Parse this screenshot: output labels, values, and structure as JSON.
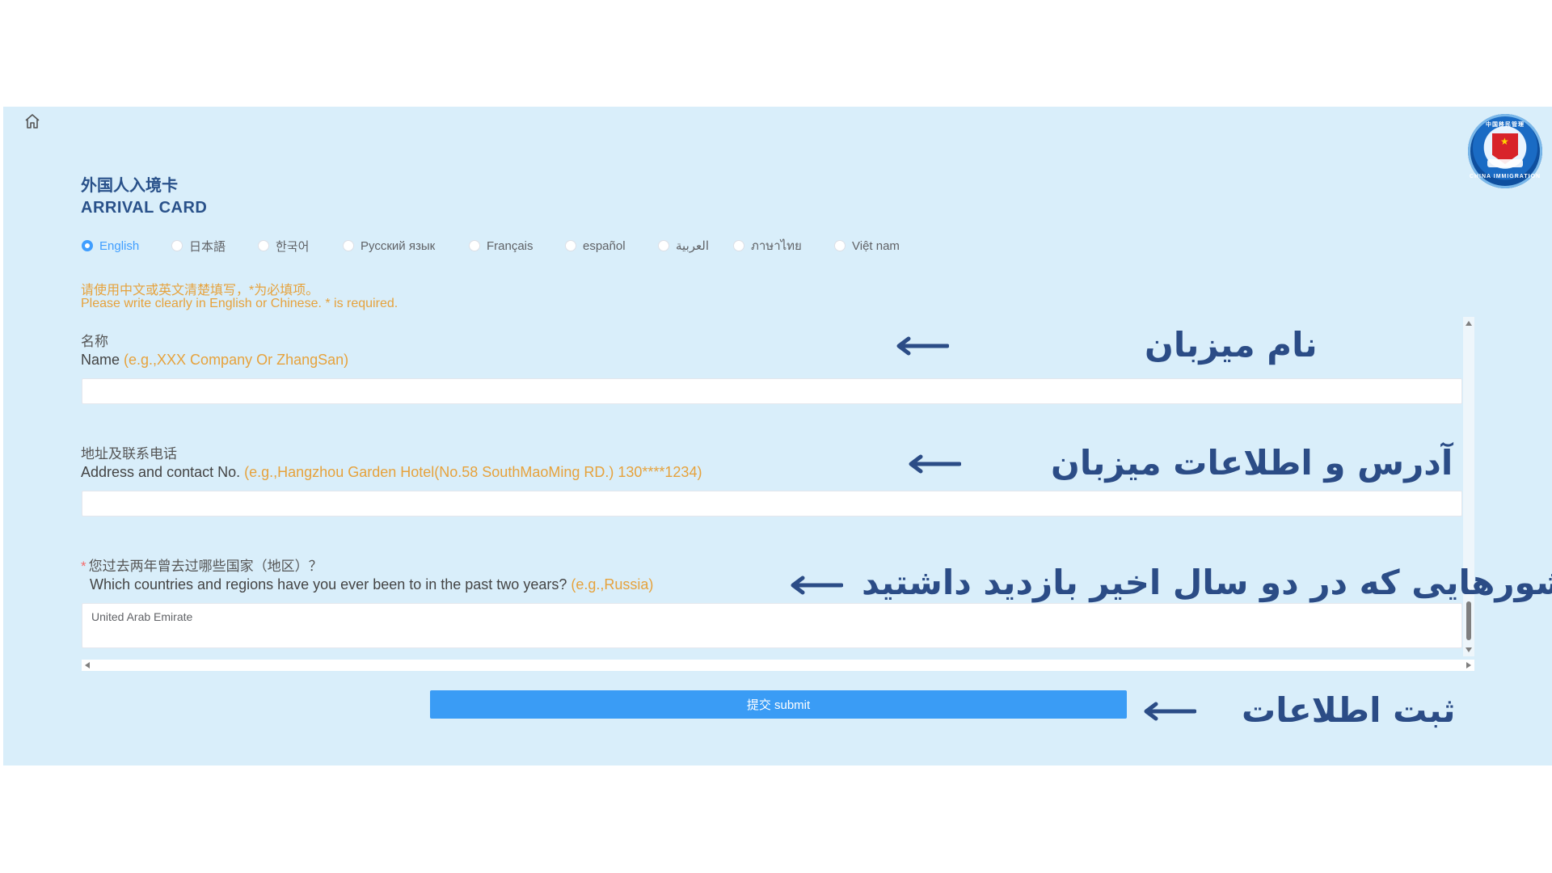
{
  "header": {
    "title_cn": "外国人入境卡",
    "title_en": "ARRIVAL CARD"
  },
  "languages": [
    {
      "label": "English",
      "selected": true
    },
    {
      "label": "日本語",
      "selected": false
    },
    {
      "label": "한국어",
      "selected": false
    },
    {
      "label": "Русский язык",
      "selected": false
    },
    {
      "label": "Français",
      "selected": false
    },
    {
      "label": "español",
      "selected": false
    },
    {
      "label": "العربية",
      "selected": false
    },
    {
      "label": "ภาษาไทย",
      "selected": false
    },
    {
      "label": "Việt nam",
      "selected": false
    }
  ],
  "notice": {
    "cn": "请使用中文或英文清楚填写，*为必填项。",
    "en": "Please write clearly in English or Chinese. * is required."
  },
  "fields": {
    "name": {
      "label_cn": "名称",
      "label_en": "Name ",
      "example": "(e.g.,XXX Company Or ZhangSan)",
      "value": ""
    },
    "address": {
      "label_cn": "地址及联系电话",
      "label_en": "Address and contact No. ",
      "example": "(e.g.,Hangzhou Garden Hotel(No.58 SouthMaoMing RD.) 130****1234)",
      "value": ""
    },
    "countries": {
      "required_mark": "*",
      "label_cn": "您过去两年曾去过哪些国家（地区）？",
      "label_en": "Which countries and regions have you ever been to in the past two years? ",
      "example": "(e.g.,Russia)",
      "value": "United Arab Emirate"
    }
  },
  "submit_label": "提交 submit",
  "annotations": {
    "name": "نام میزبان",
    "address": "آدرس و اطلاعات میزبان",
    "countries": "کشورهایی که در دو سال اخیر بازدید داشتید",
    "submit": "ثبت اطلاعات"
  },
  "colors": {
    "panel_bg": "#d9eefa",
    "title": "#29518a",
    "accent": "#409eff",
    "example": "#e6a23c",
    "submit_bg": "#3a9cf5",
    "annotation": "#2b4c86"
  },
  "icons": {
    "home": "home-icon",
    "emblem": "china-immigration-emblem"
  }
}
